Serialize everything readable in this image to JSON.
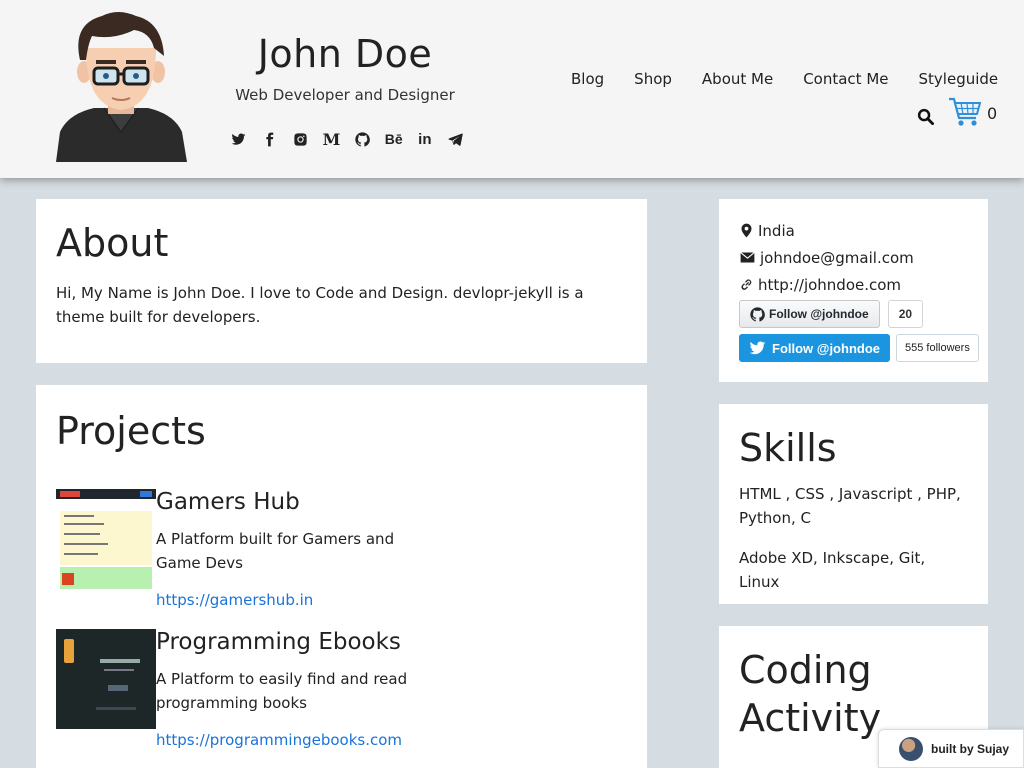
{
  "header": {
    "name": "John Doe",
    "tagline": "Web Developer and Designer",
    "socials": [
      {
        "icon": "twitter-icon"
      },
      {
        "icon": "facebook-icon"
      },
      {
        "icon": "instagram-icon"
      },
      {
        "icon": "medium-icon",
        "glyph": "M"
      },
      {
        "icon": "github-icon"
      },
      {
        "icon": "behance-icon",
        "glyph": "Bē"
      },
      {
        "icon": "linkedin-icon",
        "glyph": "in"
      },
      {
        "icon": "telegram-icon"
      }
    ],
    "nav": [
      "Blog",
      "Shop",
      "About Me",
      "Contact Me",
      "Styleguide"
    ],
    "cart_count": "0"
  },
  "about": {
    "title": "About",
    "text": "Hi, My Name is John Doe. I love to Code and Design. devlopr-jekyll is a theme built for developers."
  },
  "projects": {
    "title": "Projects",
    "items": [
      {
        "name": "Gamers Hub",
        "description": "A Platform built for Gamers and Game Devs",
        "link": "https://gamershub.in"
      },
      {
        "name": "Programming Ebooks",
        "description": "A Platform to easily find and read programming books",
        "link": "https://programmingebooks.com"
      }
    ]
  },
  "contact": {
    "location": "India",
    "email": "johndoe@gmail.com",
    "website": "http://johndoe.com",
    "github_button": "Follow @johndoe",
    "github_count": "20",
    "twitter_button": "Follow @johndoe",
    "twitter_count": "555 followers"
  },
  "skills": {
    "title": "Skills",
    "line1": "HTML , CSS , Javascript , PHP, Python, C",
    "line2": "Adobe XD, Inkscape, Git, Linux"
  },
  "coding": {
    "title": "Coding Activity"
  },
  "badge": {
    "text": "built by Sujay"
  },
  "colors": {
    "link": "#1a73d9",
    "twitter": "#1b95e0",
    "page_bg": "#d5dde3"
  }
}
